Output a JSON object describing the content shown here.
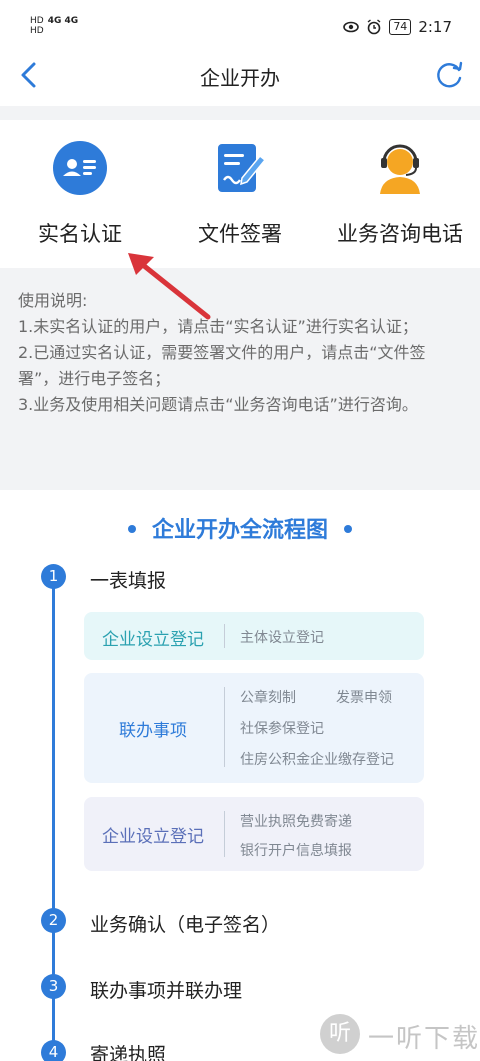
{
  "status_bar": {
    "sim1": "HD",
    "sim2": "HD",
    "signal": "4G 4G",
    "battery": "74",
    "time": "2:17"
  },
  "nav": {
    "title": "企业开办",
    "back_icon": "chevron-left-icon",
    "refresh_icon": "refresh-icon"
  },
  "quick_actions": [
    {
      "label": "实名认证",
      "icon": "id-card-icon"
    },
    {
      "label": "文件签署",
      "icon": "document-sign-icon"
    },
    {
      "label": "业务咨询电话",
      "icon": "customer-service-icon"
    }
  ],
  "instructions": {
    "heading": "使用说明:",
    "lines": [
      "1.未实名认证的用户，请点击“实名认证”进行实名认证；",
      "2.已通过实名认证，需要签署文件的用户，请点击“文件签署”，进行电子签名；",
      "3.业务及使用相关问题请点击“业务咨询电话”进行咨询。"
    ]
  },
  "flow": {
    "title": "企业开办全流程图",
    "steps": [
      {
        "number": "1",
        "label": "一表填报"
      },
      {
        "number": "2",
        "label": "业务确认（电子签名）"
      },
      {
        "number": "3",
        "label": "联办事项并联办理"
      },
      {
        "number": "4",
        "label": "寄递执照"
      }
    ],
    "boxes": [
      {
        "label": "企业设立登记",
        "items": [
          "主体设立登记"
        ]
      },
      {
        "label": "联办事项",
        "items": [
          "公章刻制",
          "发票申领",
          "社保参保登记",
          "住房公积金企业缴存登记"
        ]
      },
      {
        "label": "企业设立登记",
        "items": [
          "营业执照免费寄递",
          "银行开户信息填报"
        ]
      }
    ]
  },
  "watermark": {
    "icon_char": "听",
    "text": "一听下载"
  },
  "colors": {
    "accent": "#2e7bd9",
    "arrow": "#d9343a",
    "orange": "#f5a623"
  }
}
